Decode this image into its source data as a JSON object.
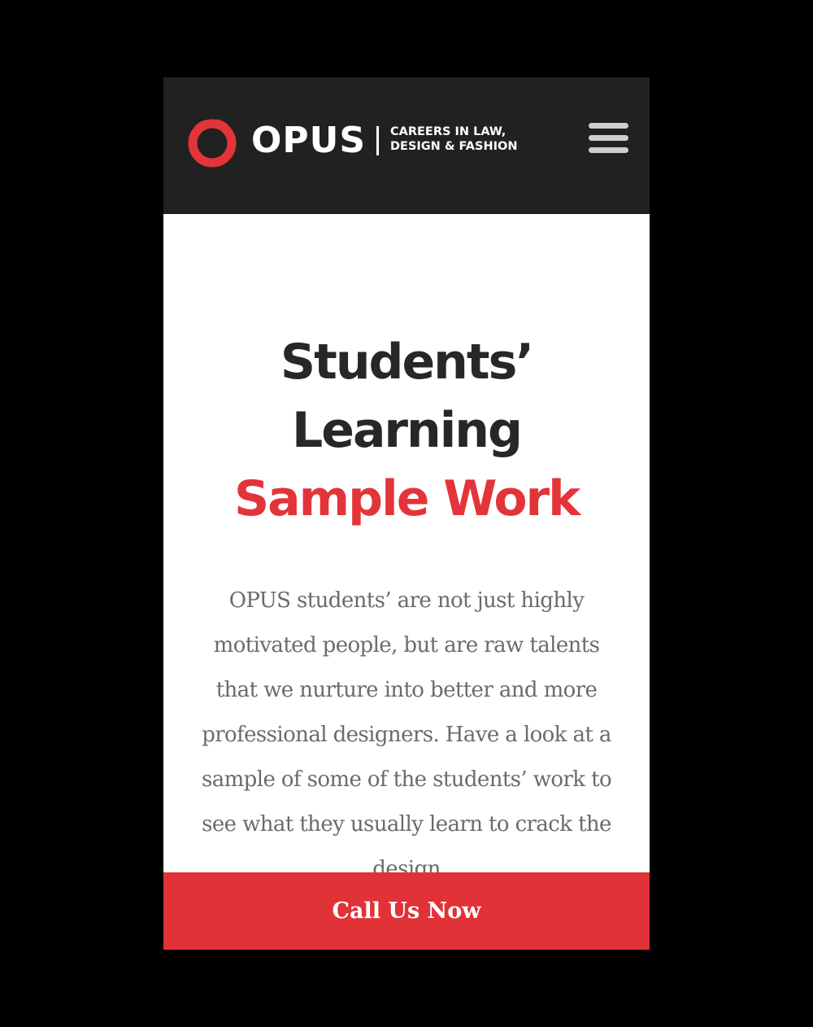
{
  "header": {
    "brand_name": "OPUS",
    "tagline_line1": "CAREERS IN LAW,",
    "tagline_line2": "DESIGN & FASHION",
    "logo_icon": "red-ring-logo-icon",
    "menu_icon": "hamburger-menu-icon"
  },
  "main": {
    "headline_line1": "Students’",
    "headline_line2": "Learning",
    "headline_line3": "Sample Work",
    "description": "OPUS students’ are not just highly motivated people, but are raw talents that we nurture into better and more professional designers. Have a look at a sample of some of the students’ work to see what they usually learn to crack the design"
  },
  "cta": {
    "label": "Call Us Now"
  },
  "colors": {
    "background": "#000000",
    "header_bg": "#212121",
    "accent_red": "#e3343a",
    "heading_dark": "#272727",
    "body_text": "#6b6b6b",
    "cta_bg": "#e03237"
  }
}
